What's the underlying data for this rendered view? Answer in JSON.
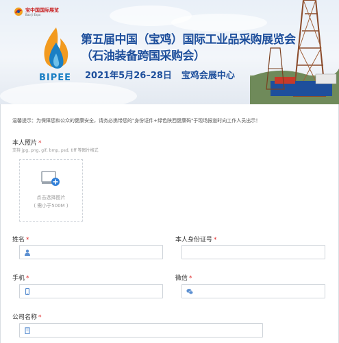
{
  "header": {
    "logo_cn": "宝中国国际展览",
    "logo_en": "Bao Ji Expo",
    "bipee": "BIPEE",
    "title_line1": "第五届中国（宝鸡）国际工业品采购展览会",
    "title_line2": "（石油装备跨国采购会）",
    "date": "2021年5月26–28日",
    "venue": "宝鸡会展中心"
  },
  "form": {
    "notice": "温馨提示：为保障您和公众的健康安全，请务必携带您的\"身份证件+绿色陕西健康码\"于现场报道时向工作人员出示！",
    "photo": {
      "label": "本人照片",
      "required": "*",
      "formats": "支持 jpg, png, gif, bmp, psd, tiff 等图片格式",
      "upload_text": "点击选择图片",
      "upload_limit": "( 需小于500M )"
    },
    "name": {
      "label": "姓名",
      "required": "*",
      "value": ""
    },
    "id_number": {
      "label": "本人身份证号",
      "required": "*",
      "value": ""
    },
    "phone": {
      "label": "手机",
      "required": "*",
      "value": ""
    },
    "wechat": {
      "label": "微信",
      "required": "*",
      "value": ""
    },
    "company": {
      "label": "公司名称",
      "required": "*",
      "value": ""
    }
  },
  "colors": {
    "title_blue": "#1e4f9c",
    "required_red": "#e02b2b",
    "border": "#cfd4da",
    "icon_blue": "#5b8fd1"
  },
  "icons": [
    "user-icon",
    "mobile-icon",
    "wechat-icon",
    "company-icon",
    "image-upload-icon"
  ]
}
